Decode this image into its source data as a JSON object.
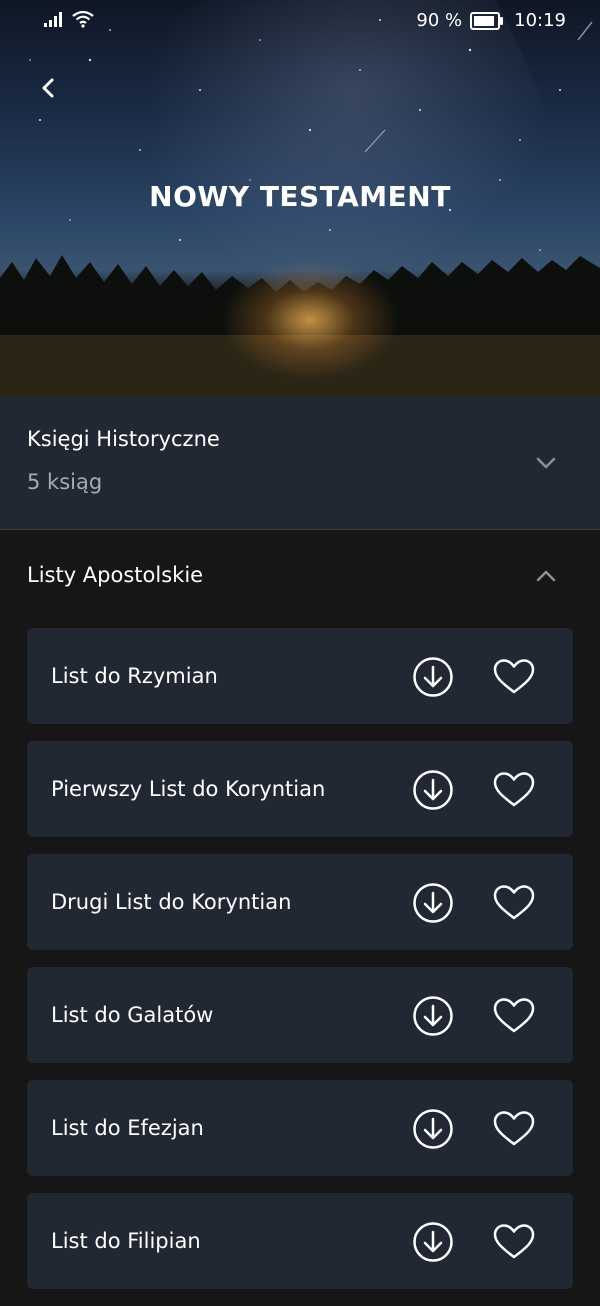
{
  "status_bar": {
    "battery_text": "90 %",
    "time": "10:19",
    "battery_level": 0.9,
    "icons": [
      "signal-icon",
      "wifi-icon",
      "battery-icon"
    ]
  },
  "header": {
    "title": "NOWY TESTAMENT",
    "back_icon": "chevron-left-icon"
  },
  "sections": [
    {
      "title": "Księgi Historyczne",
      "subtitle": "5 ksiąg",
      "expanded": false,
      "toggle_icon": "chevron-down-icon"
    },
    {
      "title": "Listy Apostolskie",
      "expanded": true,
      "toggle_icon": "chevron-up-icon",
      "items": [
        {
          "label": "List do Rzymian"
        },
        {
          "label": "Pierwszy List do Koryntian"
        },
        {
          "label": "Drugi List do Koryntian"
        },
        {
          "label": "List do Galatów"
        },
        {
          "label": "List do Efezjan"
        },
        {
          "label": "List do Filipian"
        }
      ]
    }
  ],
  "item_icons": {
    "download": "download-icon",
    "favorite": "heart-icon"
  },
  "colors": {
    "background": "#161616",
    "card": "#222833",
    "text": "#ffffff",
    "muted_text": "#a7aab2"
  }
}
